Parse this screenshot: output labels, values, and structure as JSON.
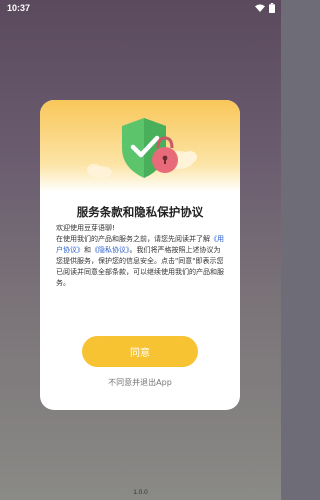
{
  "status_bar": {
    "time": "10:37",
    "icons": [
      "wifi-icon",
      "battery-icon"
    ]
  },
  "dialog": {
    "illustration": {
      "icons": [
        "shield-check-icon",
        "padlock-icon",
        "cloud-icon"
      ],
      "colors": {
        "header_top": "#f9c75a",
        "shield_green": "#5cc46b",
        "lock_pink": "#e86b7a"
      }
    },
    "title": "服务条款和隐私保护协议",
    "body": {
      "greeting": "欢迎使用豆芽语聊!",
      "line_prefix": "在使用我们的产品和服务之前，请您先阅读并了解",
      "user_agreement": "《用户协议》",
      "and": "和",
      "privacy_policy": "《隐私协议》",
      "line_suffix": "。我们将严格按照上述协议为您提供服务，保护您的信息安全。点击\"同意\"即表示您已阅读并同意全部条款，可以继续使用我们的产品和服务。"
    },
    "agree_button": "同意",
    "disagree_link": "不同意并退出App",
    "accent_color": "#f8c332"
  },
  "version": "1.0.0"
}
